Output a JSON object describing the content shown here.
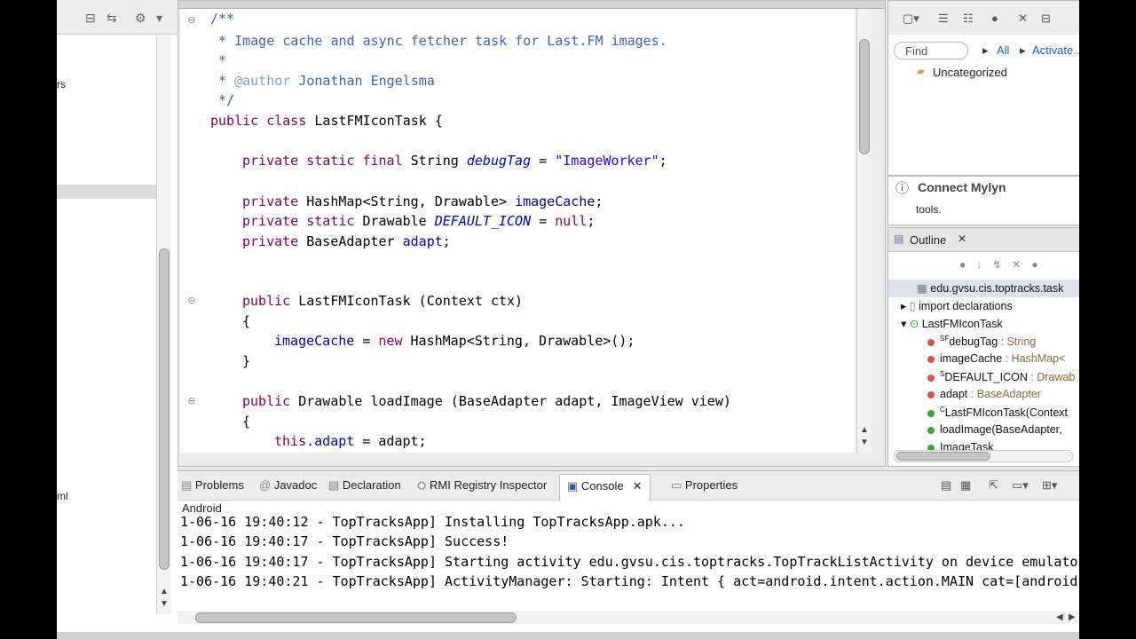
{
  "left_panel": {
    "fragments": [
      "rs",
      "ml"
    ]
  },
  "editor": {
    "comment_open": "/**",
    "comment_1": " * Image cache and async fetcher task for Last.FM images.",
    "comment_2": " *",
    "comment_3_prefix": " * ",
    "comment_3_tag": "@author",
    "comment_3_name": " Jonathan Engelsma",
    "comment_close": " */",
    "l_public": "public",
    "l_class": "class",
    "l_classname": " LastFMIconTask {",
    "l_private": "private",
    "l_static": "static",
    "l_final": "final",
    "debug_decl_type": " String ",
    "debug_name": "debugTag",
    "debug_eq": " = ",
    "debug_value": "\"ImageWorker\"",
    "debug_semi": ";",
    "cache_type": " HashMap<String, Drawable> ",
    "cache_name": "imageCache",
    "semi": ";",
    "icon_type": " Drawable ",
    "icon_name": "DEFAULT_ICON",
    "icon_eq": " = ",
    "null_kw": "null",
    "adapt_type": " BaseAdapter ",
    "adapt_name": "adapt",
    "ctor_sig": " LastFMIconTask (Context ctx)",
    "brace_open": "{",
    "brace_close": "}",
    "ctor_body_field": "imageCache",
    "ctor_body_eq": " = ",
    "new_kw": "new",
    "ctor_body_rest": " HashMap<String, Drawable>();",
    "load_sig": " Drawable loadImage (BaseAdapter adapt, ImageView view)",
    "this_kw": "this",
    "this_dot": ".",
    "this_field": "adapt",
    "this_rest": " = adapt;"
  },
  "tasks": {
    "find_placeholder": "Find",
    "all_label": "All",
    "activate_label": "Activate...",
    "category": "Uncategorized"
  },
  "mylyn": {
    "title": "Connect Mylyn",
    "subtitle": "tools."
  },
  "outline": {
    "title": "Outline",
    "package": "edu.gvsu.cis.toptracks.task",
    "imports": "import declarations",
    "class_name": "LastFMIconTask",
    "members": [
      {
        "name": "debugTag",
        "type": " : String",
        "mod": "SF",
        "color": "#d9534f"
      },
      {
        "name": "imageCache",
        "type": " : HashMap<",
        "mod": "",
        "color": "#d9534f"
      },
      {
        "name": "DEFAULT_ICON",
        "type": " : Drawab",
        "mod": "S",
        "color": "#d9534f"
      },
      {
        "name": "adapt",
        "type": " : BaseAdapter",
        "mod": "",
        "color": "#d9534f"
      },
      {
        "name": "LastFMIconTask(Context",
        "type": "",
        "mod": "C",
        "color": "#3aa53a"
      },
      {
        "name": "loadImage(BaseAdapter,",
        "type": "",
        "mod": "",
        "color": "#3aa53a"
      },
      {
        "name": "ImageTask",
        "type": "",
        "mod": "",
        "color": "#3aa53a"
      }
    ]
  },
  "console": {
    "tabs": [
      "Problems",
      "Javadoc",
      "Declaration",
      "RMI Registry Inspector",
      "Console",
      "Properties"
    ],
    "label": "Android",
    "lines": [
      "1-06-16 19:40:12 - TopTracksApp] Installing TopTracksApp.apk...",
      "1-06-16 19:40:17 - TopTracksApp] Success!",
      "1-06-16 19:40:17 - TopTracksApp] Starting activity edu.gvsu.cis.toptracks.TopTrackListActivity on device emulator",
      "1-06-16 19:40:21 - TopTracksApp] ActivityManager: Starting: Intent { act=android.intent.action.MAIN cat=[android"
    ]
  },
  "colors": {
    "keyword": "#7f0055",
    "comment": "#3f5fbf",
    "field": "#0000c0",
    "string": "#2a00ff"
  }
}
